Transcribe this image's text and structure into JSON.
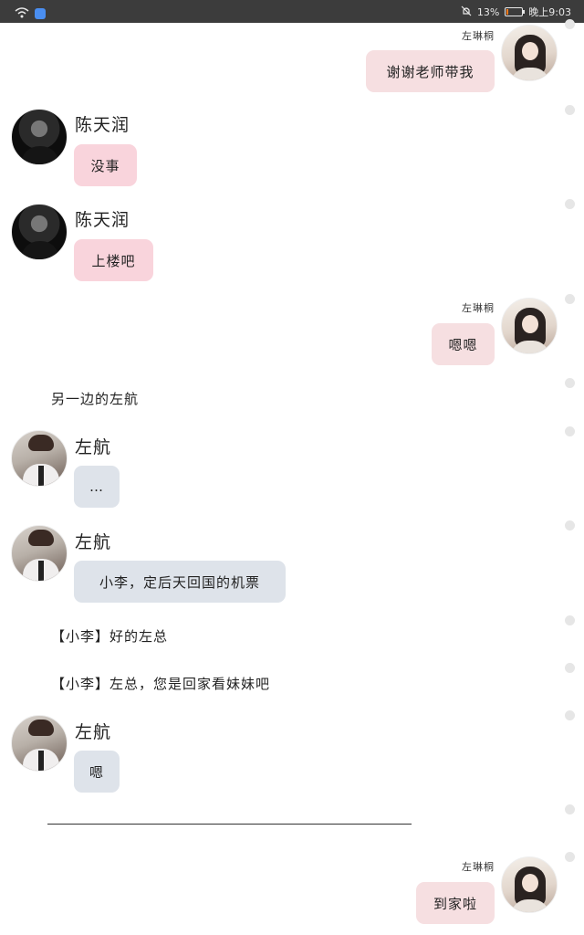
{
  "status_bar": {
    "battery_percent": "13%",
    "battery_level": 0.13,
    "time": "晚上9:03",
    "icons": [
      "wifi-icon",
      "app-icon",
      "mute-bell-icon",
      "battery-icon"
    ]
  },
  "messages": {
    "m1": {
      "sender": "左琳桐",
      "text": "谢谢老师带我"
    },
    "m2": {
      "sender": "陈天润",
      "text": "没事"
    },
    "m3": {
      "sender": "陈天润",
      "text": "上楼吧"
    },
    "m4": {
      "sender": "左琳桐",
      "text": "嗯嗯"
    },
    "narr1": "另一边的左航",
    "m5": {
      "sender": "左航",
      "text": "…"
    },
    "m6": {
      "sender": "左航",
      "text": "小李，定后天回国的机票"
    },
    "narr2": "【小李】好的左总",
    "narr3": "【小李】左总，您是回家看妹妹吧",
    "m7": {
      "sender": "左航",
      "text": "嗯"
    },
    "m8": {
      "sender": "左琳桐",
      "text": "到家啦"
    }
  },
  "colors": {
    "status_bar_bg": "#3c3c3c",
    "bubble_pink": "#f9d4dc",
    "bubble_light_pink": "#f6dfe1",
    "bubble_blue": "#dee3ea",
    "battery_low": "#ff7a1a"
  }
}
